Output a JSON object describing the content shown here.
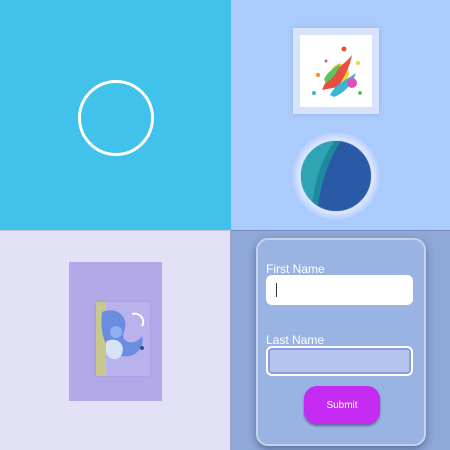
{
  "panels": {
    "top_left": {
      "bg_color": "#40c2ea",
      "ring_color": "#ffffff"
    },
    "top_right": {
      "bg_color": "#abcbfc",
      "art_icon": "abstract-splash-art",
      "globe_icon": "circle-globe"
    },
    "bottom_left": {
      "bg_color": "#e3e1f6",
      "poster_color": "#b3a9e8",
      "art_icon": "abstract-swirl-art"
    },
    "bottom_right": {
      "bg_color": "#8fa8d8"
    }
  },
  "form": {
    "first_name_label": "First Name",
    "first_name_value": "",
    "last_name_label": "Last Name",
    "last_name_value": "",
    "submit_label": "Submit",
    "submit_color": "#c52bf2"
  }
}
